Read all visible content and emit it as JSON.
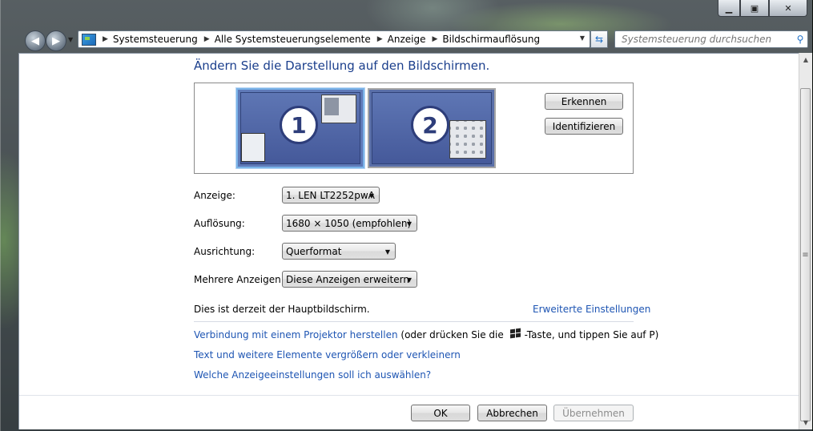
{
  "window": {
    "caption_buttons": [
      "minimize",
      "maximize",
      "close"
    ]
  },
  "nav": {
    "back_icon": "back-arrow-icon",
    "forward_icon": "forward-arrow-icon",
    "breadcrumbs": [
      "Systemsteuerung",
      "Alle Systemsteuerungselemente",
      "Anzeige",
      "Bildschirmauflösung"
    ],
    "search_placeholder": "Systemsteuerung durchsuchen"
  },
  "main": {
    "heading": "Ändern Sie die Darstellung auf den Bildschirmen.",
    "monitors": [
      {
        "number": "1",
        "selected": true
      },
      {
        "number": "2",
        "selected": false
      }
    ],
    "detect_button": "Erkennen",
    "identify_button": "Identifizieren",
    "fields": {
      "display_label": "Anzeige:",
      "display_value": "1. LEN LT2252pwA",
      "resolution_label": "Auflösung:",
      "resolution_value": "1680 × 1050 (empfohlen)",
      "orientation_label": "Ausrichtung:",
      "orientation_value": "Querformat",
      "multi_label": "Mehrere Anzeigen:",
      "multi_value": "Diese Anzeigen erweitern"
    },
    "primary_text": "Dies ist derzeit der Hauptbildschirm.",
    "advanced_link": "Erweiterte Einstellungen",
    "projector_link": "Verbindung mit einem Projektor herstellen",
    "projector_hint_a": "(oder drücken Sie die",
    "projector_hint_b": "-Taste, und tippen Sie auf P)",
    "enlarge_link": "Text und weitere Elemente vergrößern oder verkleinern",
    "which_link": "Welche Anzeigeeinstellungen soll ich auswählen?"
  },
  "footer": {
    "ok": "OK",
    "cancel": "Abbrechen",
    "apply": "Übernehmen"
  }
}
